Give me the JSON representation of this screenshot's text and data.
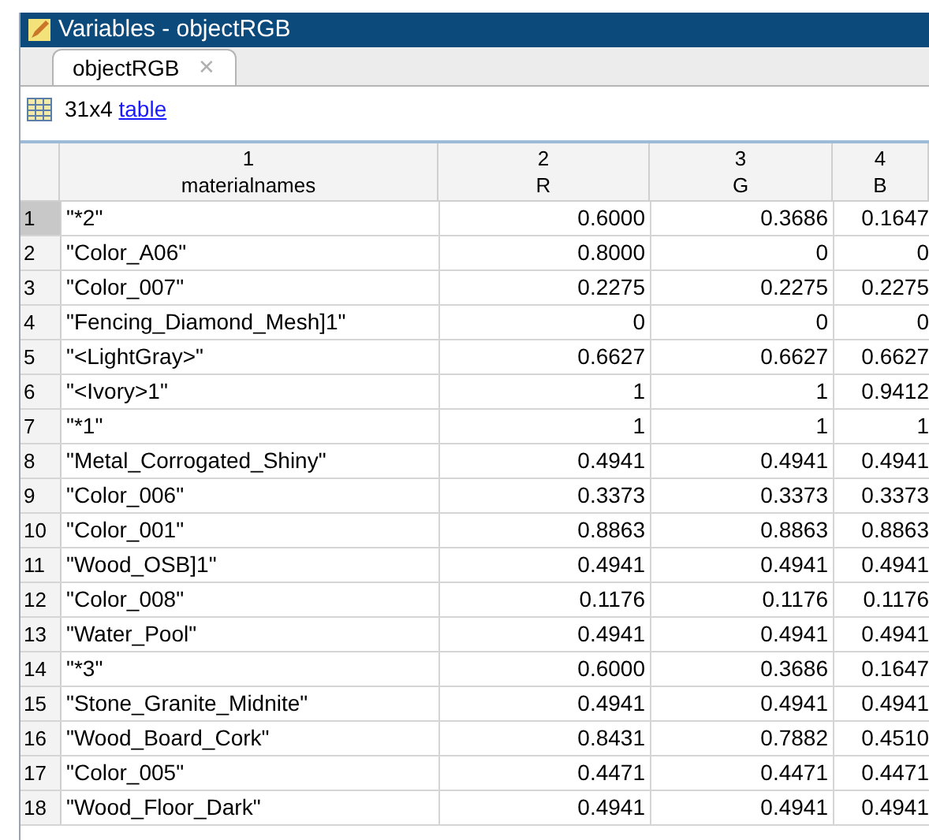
{
  "window": {
    "title": "Variables - objectRGB"
  },
  "tabs": [
    {
      "label": "objectRGB",
      "selected": true,
      "close": "✕"
    }
  ],
  "info": {
    "size": "31x4",
    "class_link": "table"
  },
  "table": {
    "columns": [
      {
        "index": "1",
        "name": "materialnames"
      },
      {
        "index": "2",
        "name": "R"
      },
      {
        "index": "3",
        "name": "G"
      },
      {
        "index": "4",
        "name": "B"
      }
    ],
    "rows": [
      {
        "number": "1",
        "selected": true,
        "cells": [
          "\"*2\"",
          "0.6000",
          "0.3686",
          "0.1647"
        ]
      },
      {
        "number": "2",
        "selected": false,
        "cells": [
          "\"Color_A06\"",
          "0.8000",
          "0",
          "0"
        ]
      },
      {
        "number": "3",
        "selected": false,
        "cells": [
          "\"Color_007\"",
          "0.2275",
          "0.2275",
          "0.2275"
        ]
      },
      {
        "number": "4",
        "selected": false,
        "cells": [
          "\"Fencing_Diamond_Mesh]1\"",
          "0",
          "0",
          "0"
        ]
      },
      {
        "number": "5",
        "selected": false,
        "cells": [
          "\"<LightGray>\"",
          "0.6627",
          "0.6627",
          "0.6627"
        ]
      },
      {
        "number": "6",
        "selected": false,
        "cells": [
          "\"<Ivory>1\"",
          "1",
          "1",
          "0.9412"
        ]
      },
      {
        "number": "7",
        "selected": false,
        "cells": [
          "\"*1\"",
          "1",
          "1",
          "1"
        ]
      },
      {
        "number": "8",
        "selected": false,
        "cells": [
          "\"Metal_Corrogated_Shiny\"",
          "0.4941",
          "0.4941",
          "0.4941"
        ]
      },
      {
        "number": "9",
        "selected": false,
        "cells": [
          "\"Color_006\"",
          "0.3373",
          "0.3373",
          "0.3373"
        ]
      },
      {
        "number": "10",
        "selected": false,
        "cells": [
          "\"Color_001\"",
          "0.8863",
          "0.8863",
          "0.8863"
        ]
      },
      {
        "number": "11",
        "selected": false,
        "cells": [
          "\"Wood_OSB]1\"",
          "0.4941",
          "0.4941",
          "0.4941"
        ]
      },
      {
        "number": "12",
        "selected": false,
        "cells": [
          "\"Color_008\"",
          "0.1176",
          "0.1176",
          "0.1176"
        ]
      },
      {
        "number": "13",
        "selected": false,
        "cells": [
          "\"Water_Pool\"",
          "0.4941",
          "0.4941",
          "0.4941"
        ]
      },
      {
        "number": "14",
        "selected": false,
        "cells": [
          "\"*3\"",
          "0.6000",
          "0.3686",
          "0.1647"
        ]
      },
      {
        "number": "15",
        "selected": false,
        "cells": [
          "\"Stone_Granite_Midnite\"",
          "0.4941",
          "0.4941",
          "0.4941"
        ]
      },
      {
        "number": "16",
        "selected": false,
        "cells": [
          "\"Wood_Board_Cork\"",
          "0.8431",
          "0.7882",
          "0.4510"
        ]
      },
      {
        "number": "17",
        "selected": false,
        "cells": [
          "\"Color_005\"",
          "0.4471",
          "0.4471",
          "0.4471"
        ]
      },
      {
        "number": "18",
        "selected": false,
        "cells": [
          "\"Wood_Floor_Dark\"",
          "0.4941",
          "0.4941",
          "0.4941"
        ]
      }
    ]
  }
}
